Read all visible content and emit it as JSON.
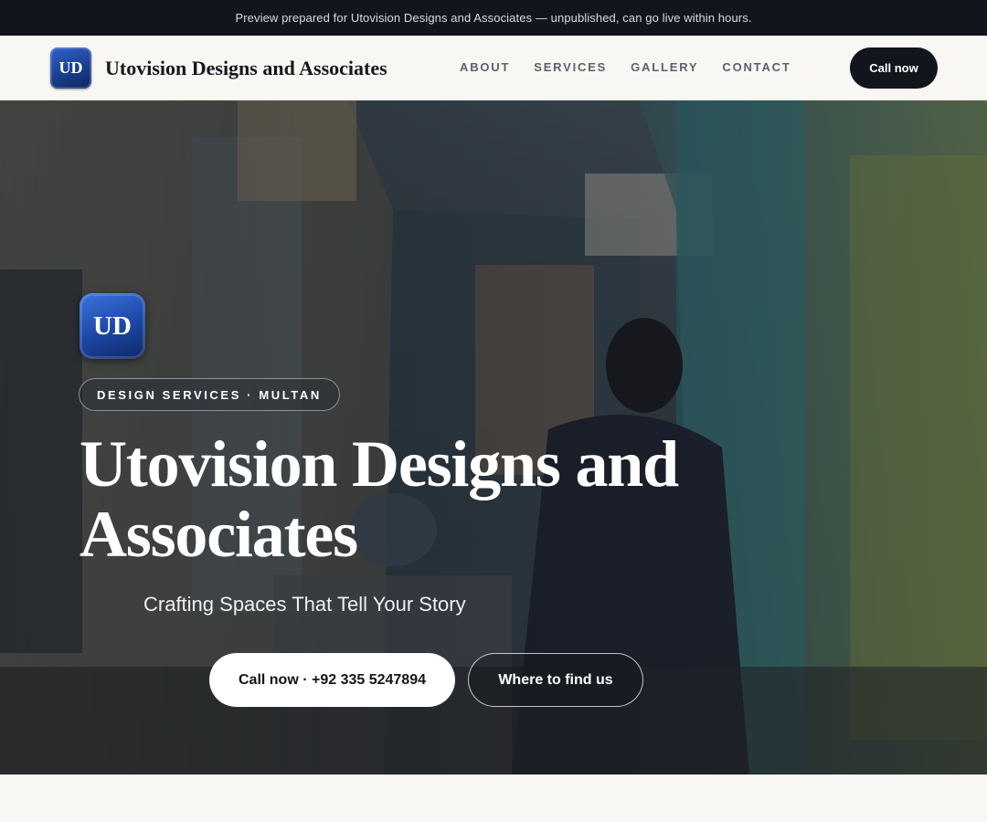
{
  "banner": {
    "text": "Preview prepared for Utovision Designs and Associates — unpublished, can go live within hours."
  },
  "header": {
    "logo_text": "UD",
    "brand_name": "Utovision Designs and Associates",
    "nav": [
      "ABOUT",
      "SERVICES",
      "GALLERY",
      "CONTACT"
    ],
    "cta_label": "Call now"
  },
  "hero": {
    "logo_text": "UD",
    "pill": "DESIGN SERVICES · MULTAN",
    "title": "Utovision Designs and Associates",
    "tagline": "Crafting Spaces That Tell Your Story",
    "primary_button": "Call now · +92 335 5247894",
    "secondary_button": "Where to find us",
    "background_icon": "market-alley-photo"
  },
  "colors": {
    "banner_bg": "#12151b",
    "page_bg": "#f8f7f3",
    "brand_blue": "#1c46a3",
    "dark_button": "#12151b"
  }
}
